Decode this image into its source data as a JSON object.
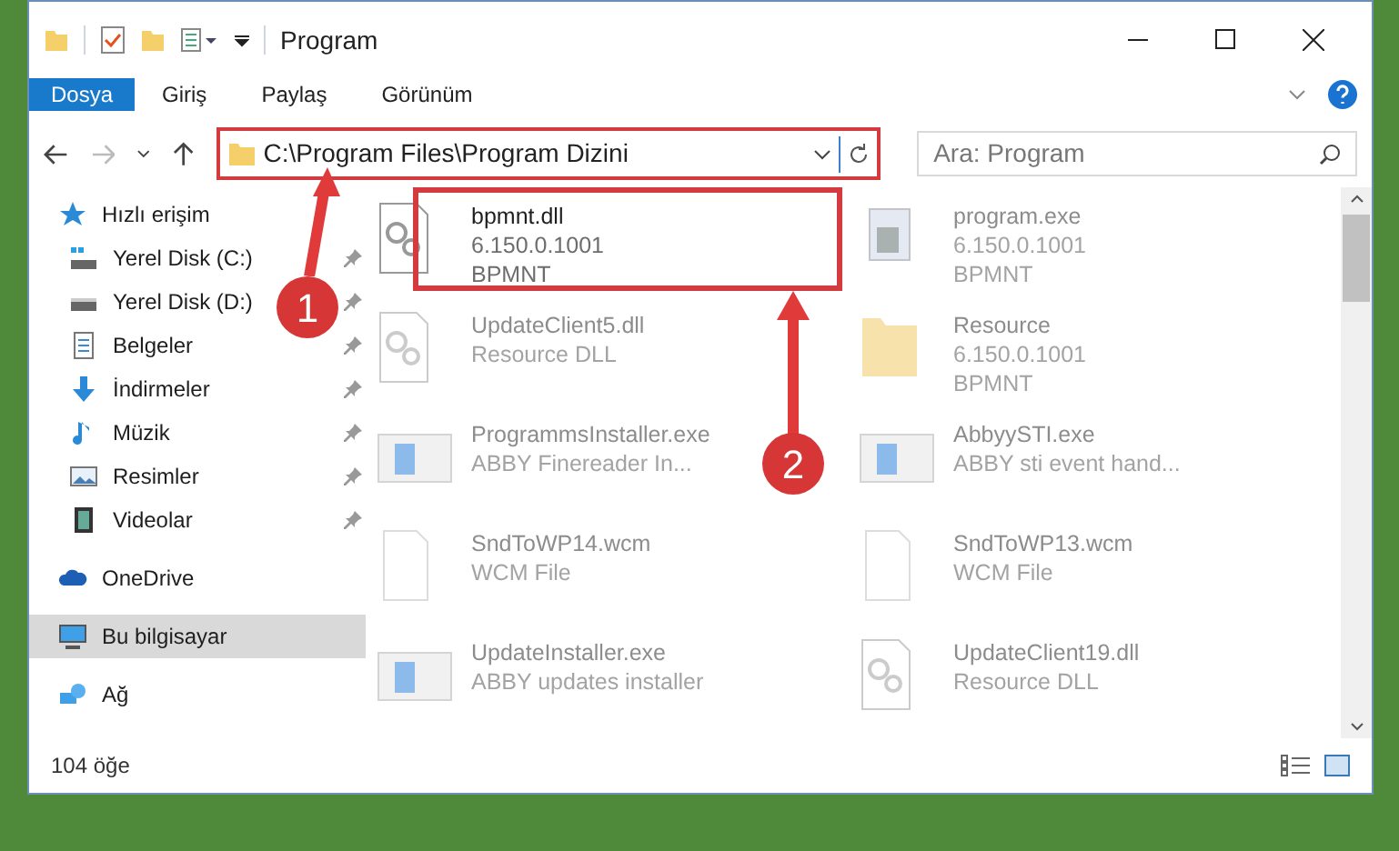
{
  "window": {
    "title": "Program"
  },
  "ribbon_tabs": [
    {
      "label": "Dosya",
      "selected": true
    },
    {
      "label": "Giriş",
      "selected": false
    },
    {
      "label": "Paylaş",
      "selected": false
    },
    {
      "label": "Görünüm",
      "selected": false
    }
  ],
  "address": {
    "value": "C:\\Program Files\\Program Dizini"
  },
  "search": {
    "placeholder": "Ara: Program"
  },
  "nav": [
    {
      "label": "Hızlı erişim",
      "kind": "star",
      "pinned": false,
      "selected": false,
      "children": [
        {
          "label": "Yerel Disk (C:)",
          "kind": "drive-c",
          "pinned": true,
          "selected": false
        },
        {
          "label": "Yerel Disk (D:)",
          "kind": "drive",
          "pinned": true,
          "selected": false
        },
        {
          "label": "Belgeler",
          "kind": "docs",
          "pinned": true,
          "selected": false
        },
        {
          "label": "İndirmeler",
          "kind": "download",
          "pinned": true,
          "selected": false
        },
        {
          "label": "Müzik",
          "kind": "music",
          "pinned": true,
          "selected": false
        },
        {
          "label": "Resimler",
          "kind": "pictures",
          "pinned": true,
          "selected": false
        },
        {
          "label": "Videolar",
          "kind": "videos",
          "pinned": true,
          "selected": false
        }
      ]
    },
    {
      "label": "OneDrive",
      "kind": "cloud",
      "pinned": false,
      "selected": false
    },
    {
      "label": "Bu bilgisayar",
      "kind": "pc",
      "pinned": false,
      "selected": true
    },
    {
      "label": "Ağ",
      "kind": "network",
      "pinned": false,
      "selected": false
    }
  ],
  "files": [
    {
      "name": "bpmnt.dll",
      "lines": [
        "6.150.0.1001",
        "BPMNT"
      ],
      "kind": "dll",
      "faded": false
    },
    {
      "name": "program.exe",
      "lines": [
        "6.150.0.1001",
        "BPMNT"
      ],
      "kind": "app",
      "faded": true
    },
    {
      "name": "UpdateClient5.dll",
      "lines": [
        "Resource DLL"
      ],
      "kind": "dll",
      "faded": true
    },
    {
      "name": "Resource",
      "lines": [
        "6.150.0.1001",
        "BPMNT"
      ],
      "kind": "folder",
      "faded": true
    },
    {
      "name": "ProgrammsInstaller.exe",
      "lines": [
        "ABBY Finereader In..."
      ],
      "kind": "window",
      "faded": true
    },
    {
      "name": "AbbyySTI.exe",
      "lines": [
        "ABBY sti event hand..."
      ],
      "kind": "window",
      "faded": true
    },
    {
      "name": "SndToWP14.wcm",
      "lines": [
        "WCM File"
      ],
      "kind": "blank",
      "faded": true
    },
    {
      "name": "SndToWP13.wcm",
      "lines": [
        "WCM File"
      ],
      "kind": "blank",
      "faded": true
    },
    {
      "name": "UpdateInstaller.exe",
      "lines": [
        "ABBY updates installer"
      ],
      "kind": "window",
      "faded": true
    },
    {
      "name": "UpdateClient19.dll",
      "lines": [
        "Resource DLL"
      ],
      "kind": "dll",
      "faded": true
    }
  ],
  "status_bar": {
    "count": "104 öğe"
  },
  "annotations": [
    {
      "label": "1"
    },
    {
      "label": "2"
    }
  ]
}
